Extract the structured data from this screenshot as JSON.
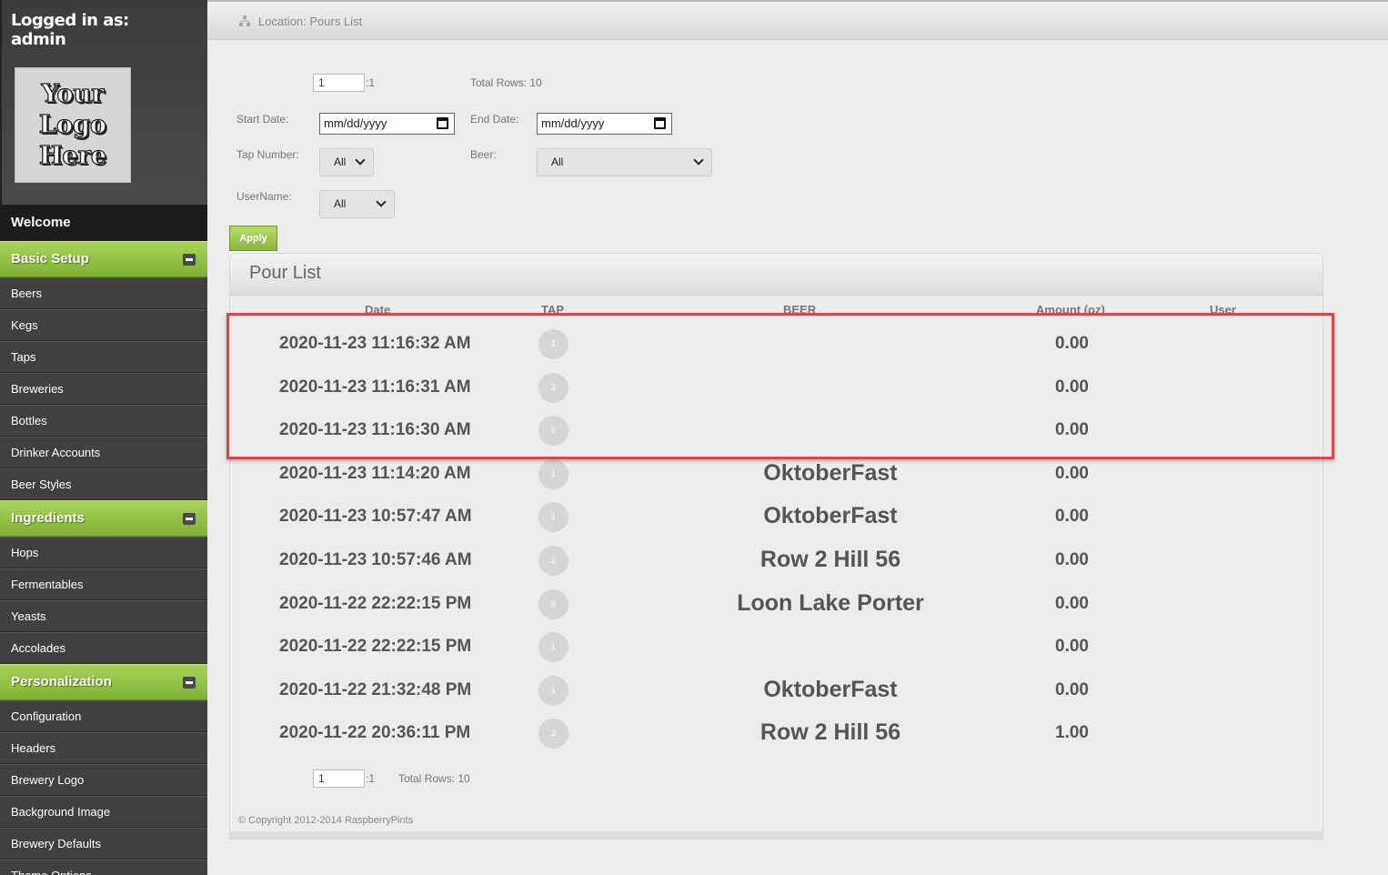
{
  "sidebar": {
    "logged_in_label": "Logged in as:",
    "username": "admin",
    "logo_lines": [
      "Your",
      "Logo",
      "Here"
    ],
    "welcome": "Welcome",
    "sections": [
      {
        "label": "Basic Setup",
        "items": [
          "Beers",
          "Kegs",
          "Taps",
          "Breweries",
          "Bottles",
          "Drinker Accounts",
          "Beer Styles"
        ]
      },
      {
        "label": "Ingredients",
        "items": [
          "Hops",
          "Fermentables",
          "Yeasts",
          "Accolades"
        ]
      },
      {
        "label": "Personalization",
        "items": [
          "Configuration",
          "Headers",
          "Brewery Logo",
          "Background Image",
          "Brewery Defaults",
          "Theme Options"
        ]
      }
    ]
  },
  "header": {
    "location": "Location: Pours List"
  },
  "pager": {
    "page": "1",
    "of": ":1",
    "total_rows": "Total Rows: 10"
  },
  "filters": {
    "start_label": "Start Date:",
    "start_value": "mm/dd/yyyy",
    "end_label": "End Date:",
    "end_value": "mm/dd/yyyy",
    "tap_label": "Tap Number:",
    "tap_value": "All",
    "beer_label": "Beer:",
    "beer_value": "All",
    "user_label": "UserName:",
    "user_value": "All",
    "apply": "Apply"
  },
  "table": {
    "title": "Pour List",
    "columns": [
      "Date",
      "TAP",
      "BEER",
      "Amount (oz)",
      "User"
    ],
    "rows": [
      {
        "date": "2020-11-23 11:16:32 AM",
        "tap": "1",
        "beer": "",
        "amount": "0.00",
        "user": ""
      },
      {
        "date": "2020-11-23 11:16:31 AM",
        "tap": "3",
        "beer": "",
        "amount": "0.00",
        "user": ""
      },
      {
        "date": "2020-11-23 11:16:30 AM",
        "tap": "2",
        "beer": "",
        "amount": "0.00",
        "user": ""
      },
      {
        "date": "2020-11-23 11:14:20 AM",
        "tap": "1",
        "beer": "OktoberFast",
        "amount": "0.00",
        "user": ""
      },
      {
        "date": "2020-11-23 10:57:47 AM",
        "tap": "1",
        "beer": "OktoberFast",
        "amount": "0.00",
        "user": ""
      },
      {
        "date": "2020-11-23 10:57:46 AM",
        "tap": "2",
        "beer": "Row 2 Hill 56",
        "amount": "0.00",
        "user": ""
      },
      {
        "date": "2020-11-22 22:22:15 PM",
        "tap": "3",
        "beer": "Loon Lake Porter",
        "amount": "0.00",
        "user": ""
      },
      {
        "date": "2020-11-22 22:22:15 PM",
        "tap": "1",
        "beer": "",
        "amount": "0.00",
        "user": ""
      },
      {
        "date": "2020-11-22 21:32:48 PM",
        "tap": "1",
        "beer": "OktoberFast",
        "amount": "0.00",
        "user": ""
      },
      {
        "date": "2020-11-22 20:36:11 PM",
        "tap": "2",
        "beer": "Row 2 Hill 56",
        "amount": "1.00",
        "user": ""
      }
    ]
  },
  "footer": {
    "copyright": "© Copyright 2012-2014 RaspberryPints"
  }
}
